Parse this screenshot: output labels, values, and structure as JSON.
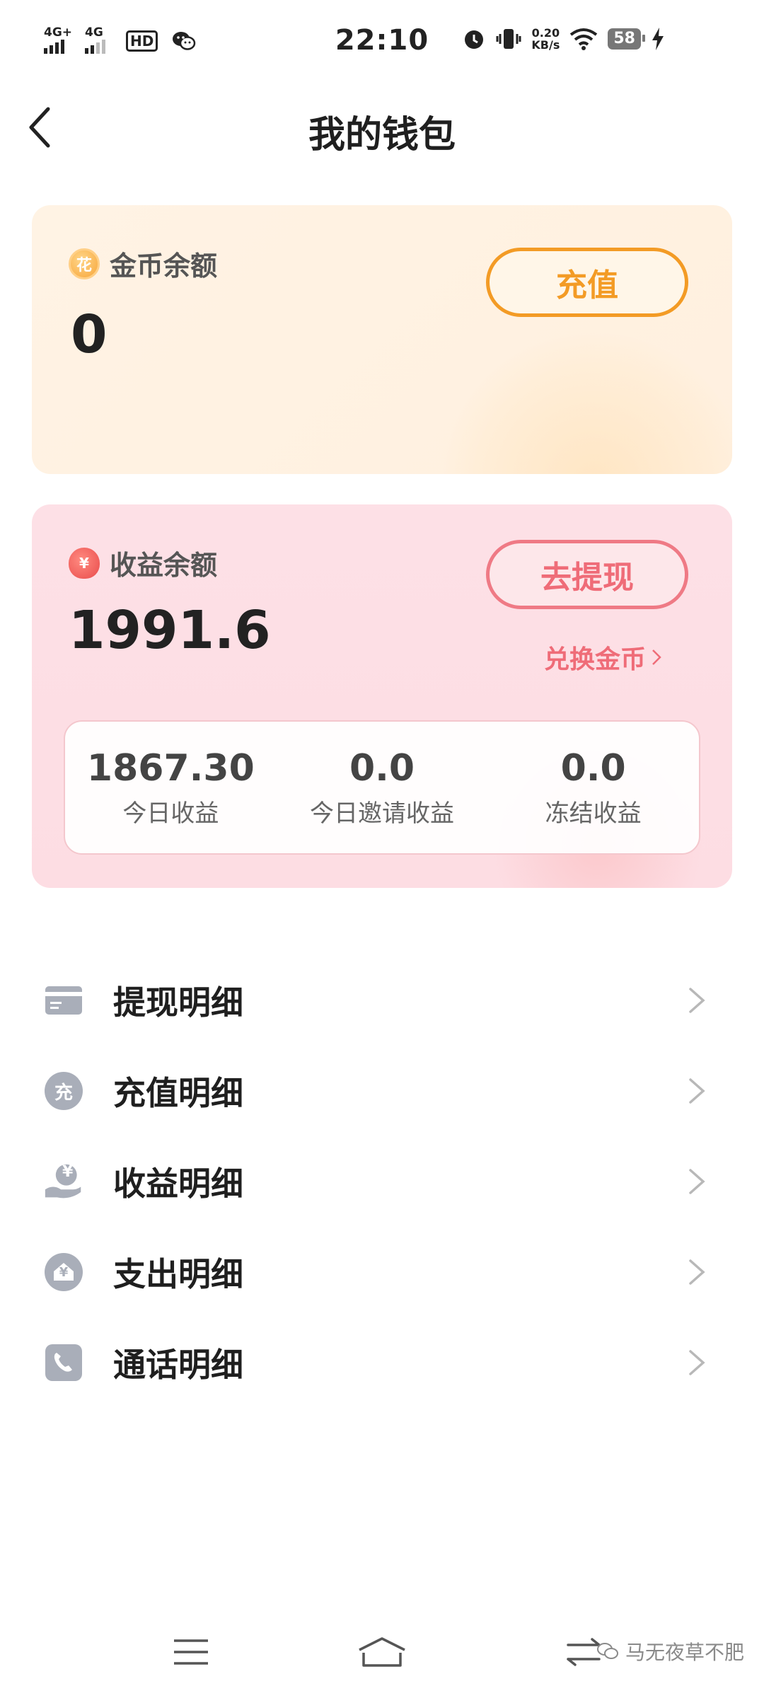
{
  "status_bar": {
    "signal1_network": "4G+",
    "signal2_network": "4G",
    "hd_label": "HD",
    "time": "22:10",
    "speed_value": "0.20",
    "speed_unit": "KB/s",
    "battery": "58"
  },
  "header": {
    "title": "我的钱包"
  },
  "gold_card": {
    "coin_symbol": "花",
    "label": "金币余额",
    "value": "0",
    "recharge_label": "充值"
  },
  "earn_card": {
    "bag_symbol": "¥",
    "label": "收益余额",
    "value": "1991.6",
    "withdraw_label": "去提现",
    "exchange_label": "兑换金币",
    "stats": [
      {
        "value": "1867.30",
        "label": "今日收益"
      },
      {
        "value": "0.0",
        "label": "今日邀请收益"
      },
      {
        "value": "0.0",
        "label": "冻结收益"
      }
    ]
  },
  "menu": {
    "items": [
      {
        "label": "提现明细",
        "icon": "card-icon"
      },
      {
        "label": "充值明细",
        "icon": "recharge-icon",
        "icon_text": "充"
      },
      {
        "label": "收益明细",
        "icon": "hand-coin-icon",
        "icon_text": "¥"
      },
      {
        "label": "支出明细",
        "icon": "house-icon",
        "icon_text": "¥"
      },
      {
        "label": "通话明细",
        "icon": "phone-icon"
      }
    ]
  },
  "watermark": {
    "text": "马无夜草不肥"
  },
  "colors": {
    "gold_accent": "#f39b25",
    "pink_accent": "#ef6c78",
    "icon_gray": "#a9aeb9"
  }
}
